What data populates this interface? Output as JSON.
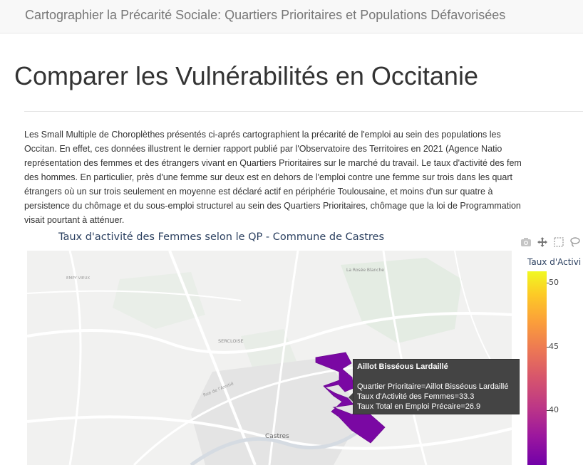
{
  "navbar": {
    "brand": "Cartographier la Précarité Sociale: Quartiers Prioritaires et Populations Défavorisées"
  },
  "page": {
    "title": "Comparer les Vulnérabilités en Occitanie"
  },
  "intro": {
    "lines": [
      "Les Small Multiple de Choroplèthes présentés ci-aprés cartographient la précarité de l'emploi au sein des populations les",
      "Occitan. En effet, ces données illustrent le dernier rapport publié par l'Observatoire des Territoires en 2021 (Agence Natio",
      "représentation des femmes et des étrangers vivant en Quartiers Prioritaires sur le marché du travail. Le taux d'activité des fem",
      "des hommes. En particulier, près d'une femme sur deux est en dehors de l'emploi contre une femme sur trois dans les quart",
      "étrangers où un sur trois seulement en moyenne est déclaré actif en périphérie Toulousaine, et moins d'un sur quatre à",
      "persistence du chômage et du sous-emploi structurel au sein des Quartiers Prioritaires, chômage que la loi de Programmation",
      "visait pourtant à atténuer."
    ]
  },
  "chart": {
    "title": "Taux d'activité des Femmes selon le QP - Commune de Castres",
    "colorbar_title": "Taux d'Activi",
    "colorbar_ticks": [
      "50",
      "45",
      "40"
    ],
    "colorscale": [
      "#f0f921",
      "#fdca26",
      "#fb9f3a",
      "#ed7953",
      "#d8576b",
      "#bd3786",
      "#9c179e",
      "#7201a8"
    ],
    "region_color": "#7a08a3",
    "modebar_icons": [
      "camera-icon",
      "pan-icon",
      "box-select-icon",
      "lasso-icon"
    ],
    "map_labels": {
      "city": "Castres",
      "district": "SERCLOISE",
      "north": "La Rosée Blanche",
      "northwest": "EMPY VIEUX",
      "road": "Rue de l'Amitié"
    }
  },
  "tooltip": {
    "title": "Aillot Bisséous Lardaillé",
    "line1": "Quartier Prioritaire=Aillot Bisséous Lardaillé",
    "line2": "Taux d'Activité des Femmes=33.3",
    "line3": "Taux Total en Emploi Précaire=26.9"
  },
  "chart_data": {
    "type": "table",
    "title": "Taux d'activité des Femmes selon le QP - Commune de Castres",
    "colorbar_title": "Taux d'Activi",
    "colorbar_ticks": [
      50,
      45,
      40
    ],
    "rows": [
      {
        "quartier_prioritaire": "Aillot Bisséous Lardaillé",
        "taux_activite_femmes": 33.3,
        "taux_total_emploi_precaire": 26.9
      }
    ]
  }
}
